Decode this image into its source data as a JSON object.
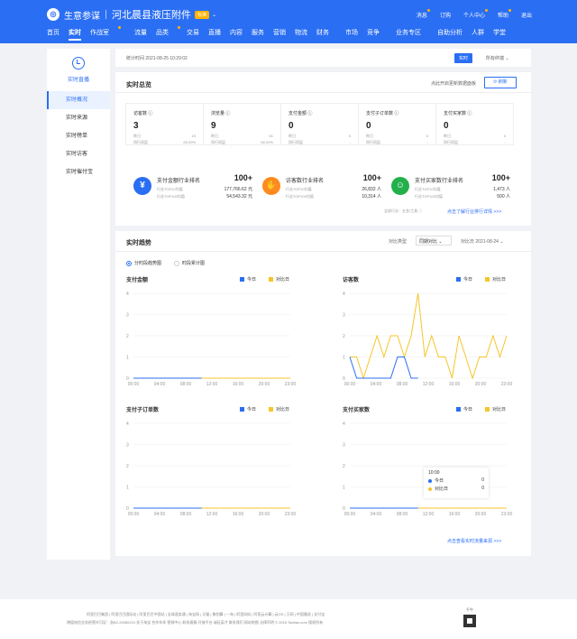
{
  "header": {
    "brand": "生意参谋",
    "shop": "河北晨县液压附件",
    "badge": "标准",
    "right": [
      "消息",
      "订购",
      "个人中心",
      "帮助",
      "退出"
    ],
    "nav": [
      "首页",
      "实时",
      "作战室",
      "流量",
      "品类",
      "交易",
      "直播",
      "内容",
      "服务",
      "营销",
      "物流",
      "财务",
      "市场",
      "竞争",
      "业务专区",
      "自助分析",
      "人群",
      "学堂"
    ]
  },
  "sidebar": {
    "title": "实时直播",
    "items": [
      "实时概况",
      "实时来源",
      "实时榜单",
      "实时访客",
      "实时催付宝"
    ]
  },
  "statbar": {
    "time": "统计时间 2021-08-25 10:29:02",
    "realtime_btn": "实时",
    "terminal": "所有终端 ⌄"
  },
  "overview": {
    "title": "实时总览",
    "auto": "点此开启更新数据面板",
    "refresh": "刷新",
    "metrics": [
      {
        "label": "访客数",
        "value": "3",
        "l1": "昨日",
        "v1": "15",
        "l2": "同行同层",
        "v2": "66.00%"
      },
      {
        "label": "浏览量",
        "value": "9",
        "l1": "昨日",
        "v1": "51",
        "l2": "同行同层",
        "v2": "66.00%"
      },
      {
        "label": "支付金额",
        "value": "0",
        "l1": "昨日",
        "v1": "0",
        "l2": "同行同层",
        "v2": "-"
      },
      {
        "label": "支付子订单数",
        "value": "0",
        "l1": "昨日",
        "v1": "0",
        "l2": "同行同层",
        "v2": "-"
      },
      {
        "label": "支付买家数",
        "value": "0",
        "l1": "昨日",
        "v1": "0",
        "l2": "同行同层",
        "v2": "-"
      }
    ],
    "ranks": [
      {
        "title": "支付金额行业排名",
        "value": "100+",
        "l1": "行业TOP10均值",
        "v1": "177,766.62 元",
        "l2": "行业TOP100均值",
        "v2": "54,543.32 元",
        "icon": "yuan-icon",
        "color": "#2a6ef3"
      },
      {
        "title": "访客数行业排名",
        "value": "100+",
        "l1": "行业TOP10均值",
        "v1": "26,832 人",
        "l2": "行业TOP100均值",
        "v2": "10,314 人",
        "icon": "hand-icon",
        "color": "#ff8a1f"
      },
      {
        "title": "支付买家数行业排名",
        "value": "100+",
        "l1": "行业TOP10均值",
        "v1": "1,473 人",
        "l2": "行业TOP100均值",
        "v2": "500 人",
        "icon": "buyer-icon",
        "color": "#23b04a"
      }
    ],
    "foot1": "全部行业：五金/工具 ⓘ",
    "foot2": "点击了解行业排行详情 >>>"
  },
  "trend": {
    "title": "实时趋势",
    "compare_type_label": "对比类型",
    "compare_type": "同期对比 ⌄",
    "compare_date": "对比日 2021-08-24 ⌄",
    "radio1": "分时段趋势图",
    "radio2": "时段累计图",
    "today": "今日",
    "cmp": "对比日",
    "tip": {
      "time": "10:00",
      "today": "今日",
      "today_v": "0",
      "cmp": "对比日",
      "cmp_v": "0"
    },
    "foot": "点击查看实时流量来源 >>>"
  },
  "chart_data": [
    {
      "type": "line",
      "title": "支付金额",
      "x": [
        "00:00",
        "04:00",
        "08:00",
        "12:00",
        "16:00",
        "20:00",
        "23:00"
      ],
      "ylim": [
        0,
        4
      ],
      "yticks": [
        0,
        1,
        2,
        3,
        4
      ],
      "series": [
        {
          "name": "今日",
          "color": "#2a6ef3",
          "values": [
            0,
            0,
            0,
            0,
            0,
            0,
            0,
            0,
            0,
            0,
            0
          ]
        },
        {
          "name": "对比日",
          "color": "#f5c52a",
          "values": [
            0,
            0,
            0,
            0,
            0,
            0,
            0,
            0,
            0,
            0,
            0,
            0,
            0,
            0,
            0,
            0,
            0,
            0,
            0,
            0,
            0,
            0,
            0,
            0
          ]
        }
      ]
    },
    {
      "type": "line",
      "title": "访客数",
      "x": [
        "00:00",
        "04:00",
        "08:00",
        "12:00",
        "16:00",
        "20:00",
        "23:00"
      ],
      "ylim": [
        0,
        4
      ],
      "yticks": [
        0,
        1,
        2,
        3,
        4
      ],
      "series": [
        {
          "name": "今日",
          "color": "#2a6ef3",
          "values": [
            1,
            0,
            0,
            0,
            0,
            0,
            0,
            1,
            1,
            0,
            0
          ]
        },
        {
          "name": "对比日",
          "color": "#f5c52a",
          "values": [
            1,
            1,
            0,
            1,
            2,
            1,
            2,
            2,
            1,
            2,
            4,
            1,
            2,
            1,
            1,
            0,
            2,
            1,
            0,
            1,
            1,
            2,
            1,
            2
          ]
        }
      ]
    },
    {
      "type": "line",
      "title": "支付子订单数",
      "x": [
        "00:00",
        "04:00",
        "08:00",
        "12:00",
        "16:00",
        "20:00",
        "23:00"
      ],
      "ylim": [
        0,
        4
      ],
      "yticks": [
        0,
        1,
        2,
        3,
        4
      ],
      "series": [
        {
          "name": "今日",
          "color": "#2a6ef3",
          "values": [
            0,
            0,
            0,
            0,
            0,
            0,
            0,
            0,
            0,
            0,
            0
          ]
        },
        {
          "name": "对比日",
          "color": "#f5c52a",
          "values": [
            0,
            0,
            0,
            0,
            0,
            0,
            0,
            0,
            0,
            0,
            0,
            0,
            0,
            0,
            0,
            0,
            0,
            0,
            0,
            0,
            0,
            0,
            0,
            0
          ]
        }
      ]
    },
    {
      "type": "line",
      "title": "支付买家数",
      "x": [
        "00:00",
        "04:00",
        "08:00",
        "12:00",
        "16:00",
        "20:00",
        "23:00"
      ],
      "ylim": [
        0,
        4
      ],
      "yticks": [
        0,
        1,
        2,
        3,
        4
      ],
      "series": [
        {
          "name": "今日",
          "color": "#2a6ef3",
          "values": [
            0,
            0,
            0,
            0,
            0,
            0,
            0,
            0,
            0,
            0,
            0
          ]
        },
        {
          "name": "对比日",
          "color": "#f5c52a",
          "values": [
            0,
            0,
            0,
            0,
            0,
            0,
            0,
            0,
            0,
            0,
            0,
            0,
            0,
            0,
            0,
            0,
            0,
            0,
            0,
            0,
            0,
            0,
            0,
            0
          ]
        }
      ]
    }
  ],
  "footer": {
    "line1": "阿里巴巴集团 | 阿里巴巴国际站 | 阿里巴巴中国站 | 全球速卖通 | 淘宝网 | 天猫 | 聚划算 | 一淘 | 阿里妈妈 | 阿里云计算 | 云OS | 万网 | 中国雅虎 | 支付宝",
    "line2": "增值电信业务经营许可证：浙B2-20080224  关于淘宝  合作伙伴  营销中心  联系客服  开放平台  诚征英才  联系我们  网站地图  法律声明 © 2016 Taobao.com 版权所有",
    "qr_title": "千牛"
  }
}
